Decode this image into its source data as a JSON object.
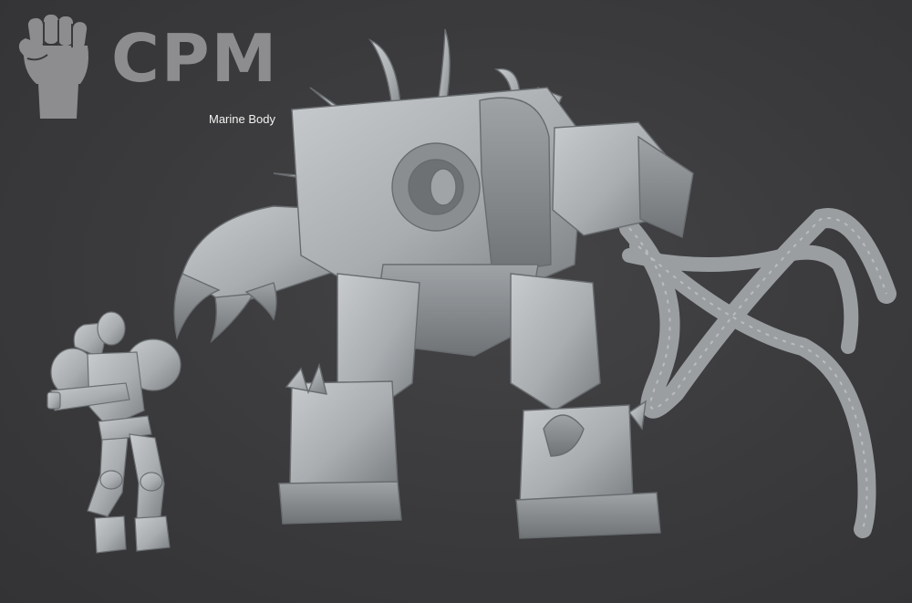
{
  "logo": {
    "text": "CPM",
    "icon": "raised-fist-icon",
    "color": "#8d8d8f"
  },
  "caption": "Marine Body",
  "colors": {
    "background": "#3a3a3c",
    "model_gray": "#a9adb0",
    "model_shadow": "#7c8083",
    "model_highlight": "#c8cbcd"
  }
}
